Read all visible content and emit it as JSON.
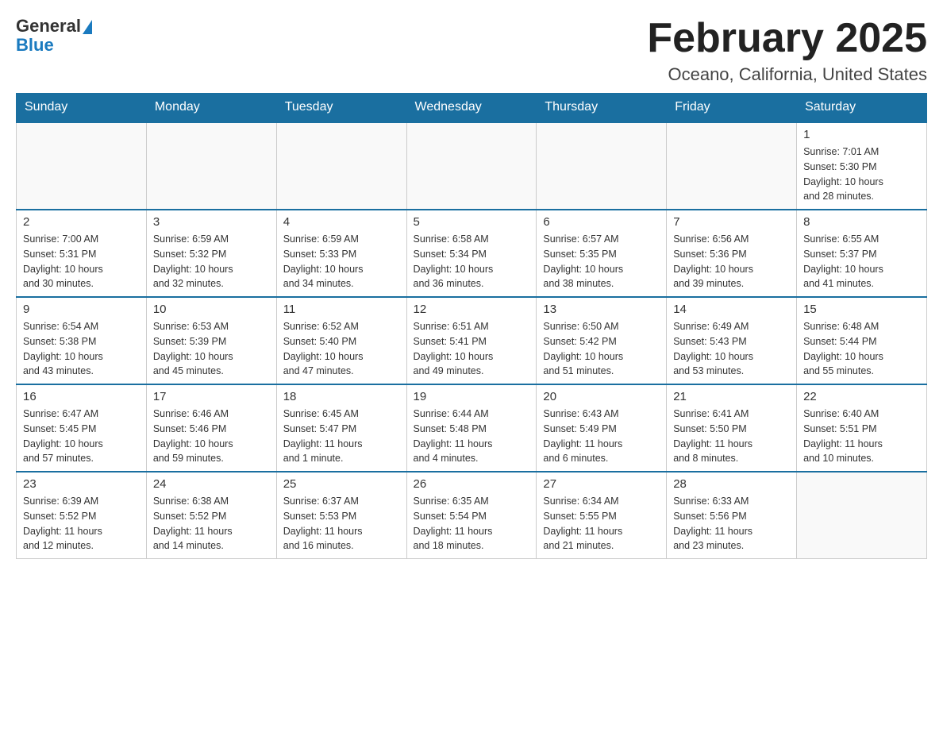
{
  "logo": {
    "general": "General",
    "blue": "Blue"
  },
  "header": {
    "title": "February 2025",
    "location": "Oceano, California, United States"
  },
  "days_of_week": [
    "Sunday",
    "Monday",
    "Tuesday",
    "Wednesday",
    "Thursday",
    "Friday",
    "Saturday"
  ],
  "weeks": [
    [
      {
        "day": "",
        "info": ""
      },
      {
        "day": "",
        "info": ""
      },
      {
        "day": "",
        "info": ""
      },
      {
        "day": "",
        "info": ""
      },
      {
        "day": "",
        "info": ""
      },
      {
        "day": "",
        "info": ""
      },
      {
        "day": "1",
        "info": "Sunrise: 7:01 AM\nSunset: 5:30 PM\nDaylight: 10 hours\nand 28 minutes."
      }
    ],
    [
      {
        "day": "2",
        "info": "Sunrise: 7:00 AM\nSunset: 5:31 PM\nDaylight: 10 hours\nand 30 minutes."
      },
      {
        "day": "3",
        "info": "Sunrise: 6:59 AM\nSunset: 5:32 PM\nDaylight: 10 hours\nand 32 minutes."
      },
      {
        "day": "4",
        "info": "Sunrise: 6:59 AM\nSunset: 5:33 PM\nDaylight: 10 hours\nand 34 minutes."
      },
      {
        "day": "5",
        "info": "Sunrise: 6:58 AM\nSunset: 5:34 PM\nDaylight: 10 hours\nand 36 minutes."
      },
      {
        "day": "6",
        "info": "Sunrise: 6:57 AM\nSunset: 5:35 PM\nDaylight: 10 hours\nand 38 minutes."
      },
      {
        "day": "7",
        "info": "Sunrise: 6:56 AM\nSunset: 5:36 PM\nDaylight: 10 hours\nand 39 minutes."
      },
      {
        "day": "8",
        "info": "Sunrise: 6:55 AM\nSunset: 5:37 PM\nDaylight: 10 hours\nand 41 minutes."
      }
    ],
    [
      {
        "day": "9",
        "info": "Sunrise: 6:54 AM\nSunset: 5:38 PM\nDaylight: 10 hours\nand 43 minutes."
      },
      {
        "day": "10",
        "info": "Sunrise: 6:53 AM\nSunset: 5:39 PM\nDaylight: 10 hours\nand 45 minutes."
      },
      {
        "day": "11",
        "info": "Sunrise: 6:52 AM\nSunset: 5:40 PM\nDaylight: 10 hours\nand 47 minutes."
      },
      {
        "day": "12",
        "info": "Sunrise: 6:51 AM\nSunset: 5:41 PM\nDaylight: 10 hours\nand 49 minutes."
      },
      {
        "day": "13",
        "info": "Sunrise: 6:50 AM\nSunset: 5:42 PM\nDaylight: 10 hours\nand 51 minutes."
      },
      {
        "day": "14",
        "info": "Sunrise: 6:49 AM\nSunset: 5:43 PM\nDaylight: 10 hours\nand 53 minutes."
      },
      {
        "day": "15",
        "info": "Sunrise: 6:48 AM\nSunset: 5:44 PM\nDaylight: 10 hours\nand 55 minutes."
      }
    ],
    [
      {
        "day": "16",
        "info": "Sunrise: 6:47 AM\nSunset: 5:45 PM\nDaylight: 10 hours\nand 57 minutes."
      },
      {
        "day": "17",
        "info": "Sunrise: 6:46 AM\nSunset: 5:46 PM\nDaylight: 10 hours\nand 59 minutes."
      },
      {
        "day": "18",
        "info": "Sunrise: 6:45 AM\nSunset: 5:47 PM\nDaylight: 11 hours\nand 1 minute."
      },
      {
        "day": "19",
        "info": "Sunrise: 6:44 AM\nSunset: 5:48 PM\nDaylight: 11 hours\nand 4 minutes."
      },
      {
        "day": "20",
        "info": "Sunrise: 6:43 AM\nSunset: 5:49 PM\nDaylight: 11 hours\nand 6 minutes."
      },
      {
        "day": "21",
        "info": "Sunrise: 6:41 AM\nSunset: 5:50 PM\nDaylight: 11 hours\nand 8 minutes."
      },
      {
        "day": "22",
        "info": "Sunrise: 6:40 AM\nSunset: 5:51 PM\nDaylight: 11 hours\nand 10 minutes."
      }
    ],
    [
      {
        "day": "23",
        "info": "Sunrise: 6:39 AM\nSunset: 5:52 PM\nDaylight: 11 hours\nand 12 minutes."
      },
      {
        "day": "24",
        "info": "Sunrise: 6:38 AM\nSunset: 5:52 PM\nDaylight: 11 hours\nand 14 minutes."
      },
      {
        "day": "25",
        "info": "Sunrise: 6:37 AM\nSunset: 5:53 PM\nDaylight: 11 hours\nand 16 minutes."
      },
      {
        "day": "26",
        "info": "Sunrise: 6:35 AM\nSunset: 5:54 PM\nDaylight: 11 hours\nand 18 minutes."
      },
      {
        "day": "27",
        "info": "Sunrise: 6:34 AM\nSunset: 5:55 PM\nDaylight: 11 hours\nand 21 minutes."
      },
      {
        "day": "28",
        "info": "Sunrise: 6:33 AM\nSunset: 5:56 PM\nDaylight: 11 hours\nand 23 minutes."
      },
      {
        "day": "",
        "info": ""
      }
    ]
  ]
}
